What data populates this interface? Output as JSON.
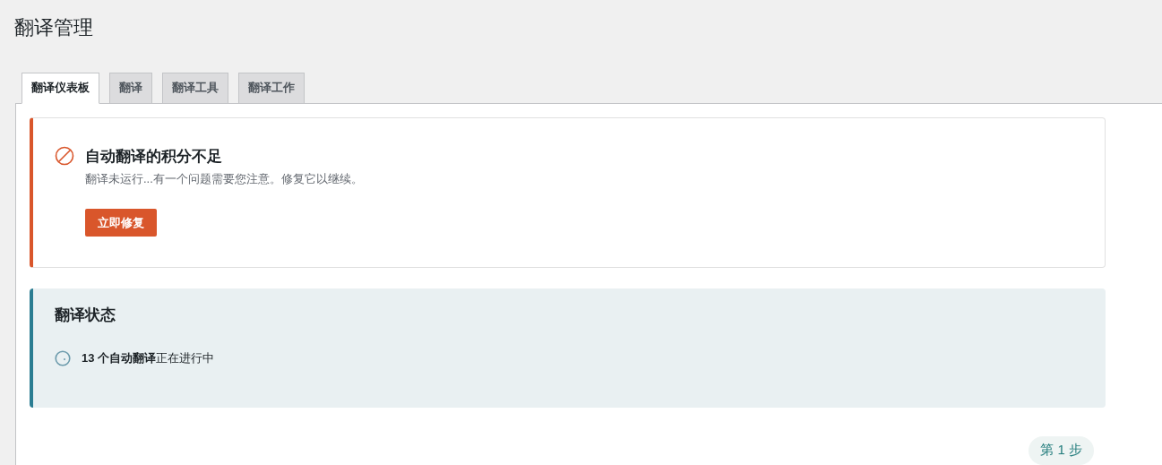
{
  "page_title": "翻译管理",
  "tabs": [
    {
      "label": "翻译仪表板",
      "selected": true
    },
    {
      "label": "翻译",
      "selected": false
    },
    {
      "label": "翻译工具",
      "selected": false
    },
    {
      "label": "翻译工作",
      "selected": false
    }
  ],
  "alert": {
    "title": "自动翻译的积分不足",
    "message": "翻译未运行...有一个问题需要您注意。修复它以继续。",
    "button": "立即修复"
  },
  "status": {
    "title": "翻译状态",
    "line": "**13 个自动翻译**正在进行中"
  },
  "step_badge": "第 1 步"
}
